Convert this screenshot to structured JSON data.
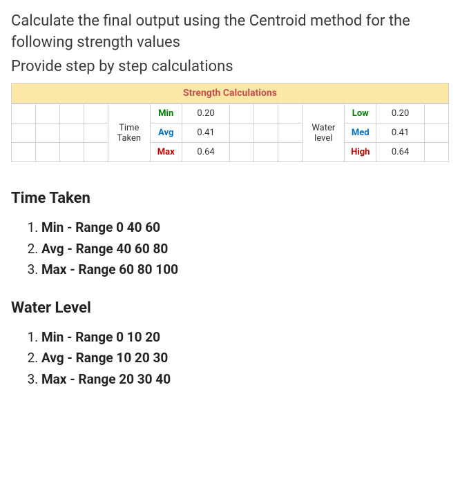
{
  "question": {
    "line1": "Calculate the final output using the Centroid method for the following strength values",
    "line2": "Provide step by step calculations"
  },
  "table": {
    "header": "Strength Calculations",
    "left": {
      "label": "Time Taken",
      "rows": [
        {
          "metric": "Min",
          "color": "green",
          "value": "0.20"
        },
        {
          "metric": "Avg",
          "color": "blue",
          "value": "0.41"
        },
        {
          "metric": "Max",
          "color": "red",
          "value": "0.64"
        }
      ]
    },
    "right": {
      "label": "Water level",
      "rows": [
        {
          "metric": "Low",
          "color": "green",
          "value": "0.20"
        },
        {
          "metric": "Med",
          "color": "blue",
          "value": "0.41"
        },
        {
          "metric": "High",
          "color": "red",
          "value": "0.64"
        }
      ]
    }
  },
  "sections": {
    "timeTaken": {
      "heading": "Time Taken",
      "items": [
        {
          "label": "Min",
          "range": "- Range 0 40 60"
        },
        {
          "label": "Avg",
          "range": "- Range 40 60 80"
        },
        {
          "label": "Max",
          "range": "- Range 60 80 100"
        }
      ]
    },
    "waterLevel": {
      "heading": "Water Level",
      "items": [
        {
          "label": "Min",
          "range": "- Range 0 10 20"
        },
        {
          "label": "Avg",
          "range": "- Range 10 20 30"
        },
        {
          "label": "Max",
          "range": "- Range 20 30 40"
        }
      ]
    }
  }
}
